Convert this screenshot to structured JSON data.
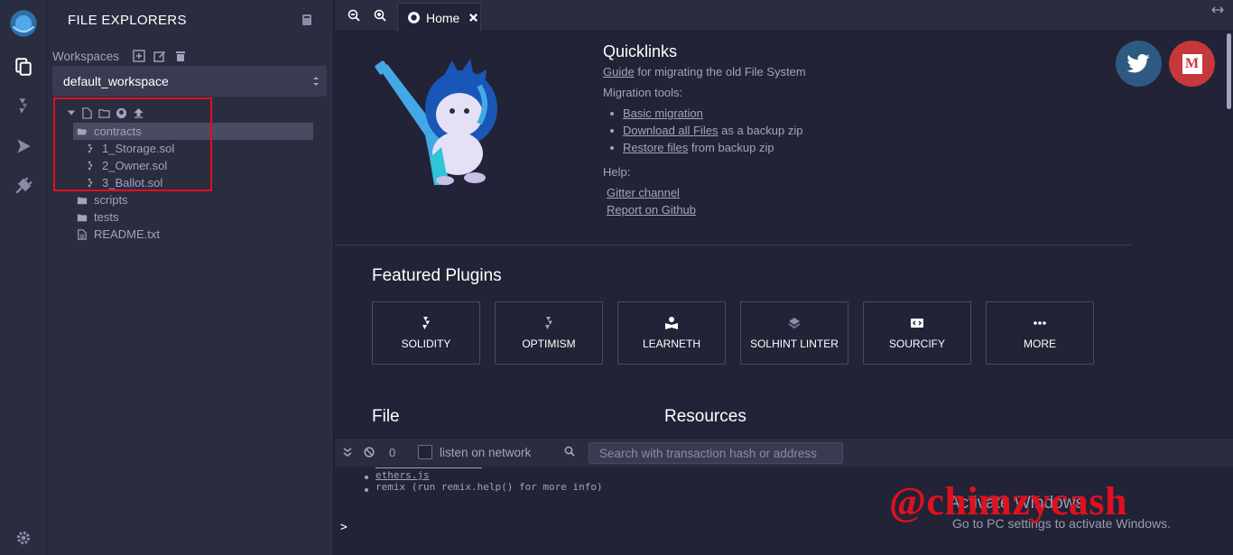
{
  "iconbar": {
    "items": [
      "remix-logo-icon",
      "file-explorer-icon",
      "solidity-compiler-icon",
      "deploy-run-icon",
      "plugin-manager-icon",
      "settings-icon"
    ]
  },
  "sidepanel": {
    "title": "FILE EXPLORERS",
    "workspaces_label": "Workspaces",
    "workspace_selected": "default_workspace",
    "tree": {
      "folder_open": "contracts",
      "files_in_contracts": [
        "1_Storage.sol",
        "2_Owner.sol",
        "3_Ballot.sol"
      ],
      "other": [
        "scripts",
        "tests",
        "README.txt"
      ]
    }
  },
  "tabs": {
    "home_label": "Home"
  },
  "home": {
    "quicklinks_title": "Quicklinks",
    "guide_link": "Guide",
    "guide_suffix": "for migrating the old File System",
    "migration_label": "Migration tools:",
    "migration_items": [
      {
        "link": "Basic migration",
        "suffix": ""
      },
      {
        "link": "Download all Files",
        "suffix": " as a backup zip"
      },
      {
        "link": "Restore files",
        "suffix": " from backup zip"
      }
    ],
    "help_label": "Help:",
    "help_links": [
      "Gitter channel",
      "Report on Github"
    ],
    "featured_title": "Featured Plugins",
    "plugins": [
      "SOLIDITY",
      "OPTIMISM",
      "LEARNETH",
      "SOLHINT LINTER",
      "SOURCIFY",
      "MORE"
    ],
    "file_heading": "File",
    "resources_heading": "Resources",
    "social": [
      "twitter-icon",
      "medium-icon"
    ],
    "social_medium_letter": "M"
  },
  "terminal": {
    "count": "0",
    "listen_label": "listen on network",
    "search_placeholder": "Search with transaction hash or address",
    "lines": [
      "ethers.js",
      "remix (run remix.help() for more info)"
    ],
    "prompt": ">",
    "activate_title": "Activate Windows",
    "activate_sub": "Go to PC settings to activate Windows."
  },
  "watermark": "@chimzycash",
  "colors": {
    "accent_red": "#e0101e",
    "panel_bg": "#2a2c3f",
    "main_bg": "#222336",
    "twitter": "#2e5a82",
    "medium": "#c5393b"
  }
}
